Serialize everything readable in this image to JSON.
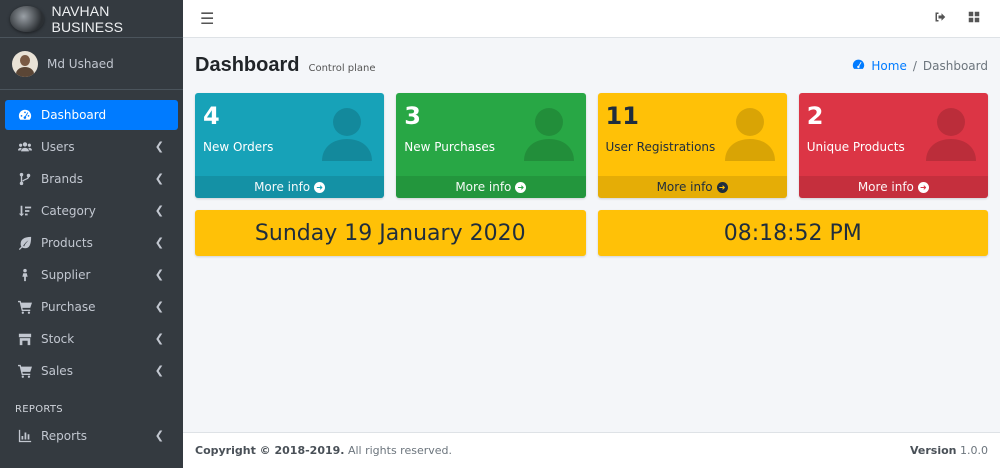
{
  "brand": {
    "title": "NAVHAN BUSINESS"
  },
  "user": {
    "name": "Md Ushaed"
  },
  "sidebar": {
    "items": [
      {
        "label": "Dashboard",
        "icon": "tachometer-icon",
        "active": true
      },
      {
        "label": "Users",
        "icon": "users-icon"
      },
      {
        "label": "Brands",
        "icon": "code-branch-icon"
      },
      {
        "label": "Category",
        "icon": "sort-icon"
      },
      {
        "label": "Products",
        "icon": "leaf-icon"
      },
      {
        "label": "Supplier",
        "icon": "person-icon"
      },
      {
        "label": "Purchase",
        "icon": "cart-icon"
      },
      {
        "label": "Stock",
        "icon": "store-icon"
      },
      {
        "label": "Sales",
        "icon": "cart-icon"
      }
    ],
    "reports_header": "REPORTS",
    "reports_item": {
      "label": "Reports",
      "icon": "bar-chart-icon"
    }
  },
  "page": {
    "title": "Dashboard",
    "subtitle": "Control plane"
  },
  "breadcrumb": {
    "home": "Home",
    "current": "Dashboard"
  },
  "stats": [
    {
      "value": "4",
      "label": "New Orders",
      "color": "#17a2b8",
      "more": "More info"
    },
    {
      "value": "3",
      "label": "New Purchases",
      "color": "#28a745",
      "more": "More info"
    },
    {
      "value": "11",
      "label": "User Registrations",
      "color": "#ffc107",
      "more": "More info"
    },
    {
      "value": "2",
      "label": "Unique Products",
      "color": "#dc3545",
      "more": "More info"
    }
  ],
  "date_display": "Sunday 19 January 2020",
  "time_display": "08:18:52 PM",
  "footer": {
    "copyright": "Copyright © 2018-2019.",
    "rights": " All rights reserved.",
    "version_label": "Version",
    "version": " 1.0.0"
  }
}
